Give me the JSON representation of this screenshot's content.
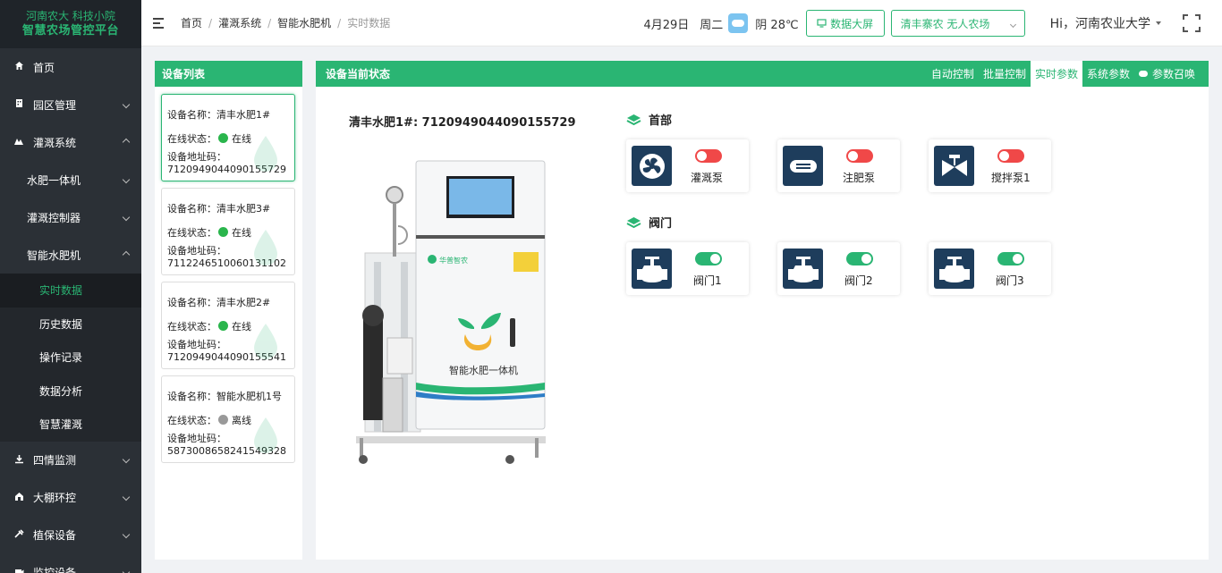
{
  "brand": {
    "line1": "河南农大 科技小院",
    "line2": "智慧农场管控平台"
  },
  "sidebar": {
    "items": [
      {
        "label": "首页",
        "icon": "home-icon"
      },
      {
        "label": "园区管理",
        "icon": "building-icon"
      },
      {
        "label": "灌溉系统",
        "icon": "irrigation-icon"
      },
      {
        "label": "水肥一体机"
      },
      {
        "label": "灌溉控制器"
      },
      {
        "label": "智能水肥机"
      },
      {
        "label": "实时数据"
      },
      {
        "label": "历史数据"
      },
      {
        "label": "操作记录"
      },
      {
        "label": "数据分析"
      },
      {
        "label": "智慧灌溉"
      },
      {
        "label": "四情监测",
        "icon": "monitor-icon"
      },
      {
        "label": "大棚环控",
        "icon": "greenhouse-icon"
      },
      {
        "label": "植保设备",
        "icon": "plant-protect-icon"
      },
      {
        "label": "监控设备",
        "icon": "camera-icon"
      }
    ]
  },
  "header": {
    "breadcrumb": [
      "首页",
      "灌溉系统",
      "智能水肥机",
      "实时数据"
    ],
    "date": "4月29日",
    "weekday": "周二",
    "weather": "阴  28℃",
    "screen_button": "数据大屏",
    "farm_select": "清丰寨农 无人农场",
    "greeting": "Hi，河南农业大学"
  },
  "device_list": {
    "title": "设备列表",
    "name_label": "设备名称：",
    "status_label": "在线状态：",
    "addr_label": "设备地址码：",
    "devices": [
      {
        "name": "清丰水肥1#",
        "status": "在线",
        "online": true,
        "addr": "7120949044090155729"
      },
      {
        "name": "清丰水肥3#",
        "status": "在线",
        "online": true,
        "addr": "7112246510060131102"
      },
      {
        "name": "清丰水肥2#",
        "status": "在线",
        "online": true,
        "addr": "7120949044090155541"
      },
      {
        "name": "智能水肥机1号",
        "status": "离线",
        "online": false,
        "addr": "5873008658241549328"
      }
    ]
  },
  "main": {
    "title": "设备当前状态",
    "tabs": [
      "自动控制",
      "批量控制",
      "实时参数",
      "系统参数",
      "参数召唤"
    ],
    "device_title": "清丰水肥1#:  7120949044090155729",
    "machine": {
      "brand": "华普智农",
      "name": "智能水肥一体机"
    },
    "sections": [
      {
        "title": "首部",
        "controls": [
          {
            "label": "灌溉泵",
            "on": false,
            "icon": "fan-icon"
          },
          {
            "label": "注肥泵",
            "on": false,
            "icon": "pump-icon"
          },
          {
            "label": "搅拌泵1",
            "on": false,
            "icon": "valve-icon"
          }
        ]
      },
      {
        "title": "阀门",
        "controls": [
          {
            "label": "阀门1",
            "on": true,
            "icon": "valve-icon"
          },
          {
            "label": "阀门2",
            "on": true,
            "icon": "valve-icon"
          },
          {
            "label": "阀门3",
            "on": true,
            "icon": "valve-icon"
          }
        ]
      }
    ]
  },
  "colors": {
    "accent": "#2ab573",
    "sidebar": "#2b3036",
    "switch_off": "#f04848",
    "icon_bg": "#1e3d5c"
  }
}
